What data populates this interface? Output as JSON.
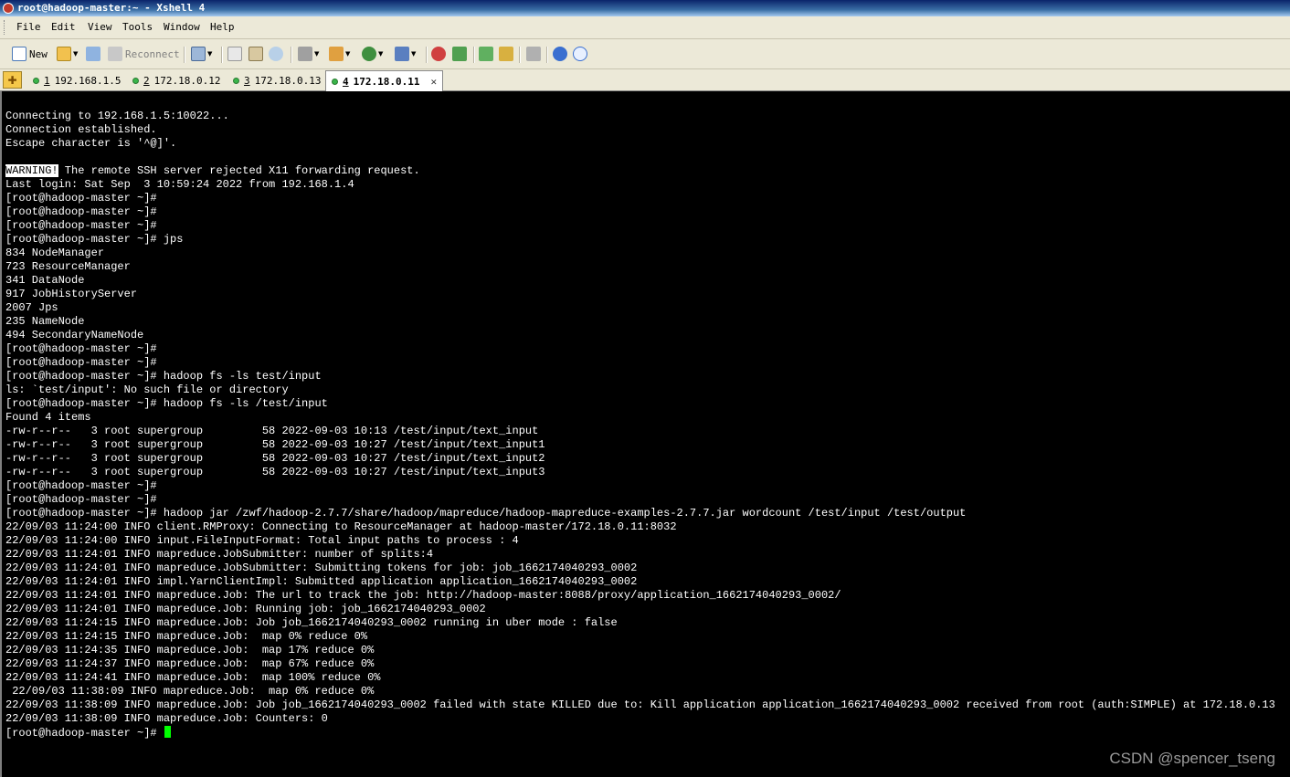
{
  "window": {
    "title": "root@hadoop-master:~ - Xshell 4"
  },
  "menu": [
    "File",
    "Edit",
    "View",
    "Tools",
    "Window",
    "Help"
  ],
  "toolbar": {
    "new_label": "New",
    "reconnect_label": "Reconnect"
  },
  "tabs": [
    {
      "num": "1",
      "host": "192.168.1.5",
      "active": false
    },
    {
      "num": "2",
      "host": "172.18.0.12",
      "active": false
    },
    {
      "num": "3",
      "host": "172.18.0.13",
      "active": false
    },
    {
      "num": "4",
      "host": "172.18.0.11",
      "active": true
    }
  ],
  "terminal": {
    "lines": [
      "Connecting to 192.168.1.5:10022...",
      "Connection established.",
      "Escape character is '^@]'.",
      "",
      "",
      "Last login: Sat Sep  3 10:59:24 2022 from 192.168.1.4",
      "[root@hadoop-master ~]#",
      "[root@hadoop-master ~]#",
      "[root@hadoop-master ~]#",
      "[root@hadoop-master ~]# jps",
      "834 NodeManager",
      "723 ResourceManager",
      "341 DataNode",
      "917 JobHistoryServer",
      "2007 Jps",
      "235 NameNode",
      "494 SecondaryNameNode",
      "[root@hadoop-master ~]#",
      "[root@hadoop-master ~]#",
      "[root@hadoop-master ~]# hadoop fs -ls test/input",
      "ls: `test/input': No such file or directory",
      "[root@hadoop-master ~]# hadoop fs -ls /test/input",
      "Found 4 items",
      "-rw-r--r--   3 root supergroup         58 2022-09-03 10:13 /test/input/text_input",
      "-rw-r--r--   3 root supergroup         58 2022-09-03 10:27 /test/input/text_input1",
      "-rw-r--r--   3 root supergroup         58 2022-09-03 10:27 /test/input/text_input2",
      "-rw-r--r--   3 root supergroup         58 2022-09-03 10:27 /test/input/text_input3",
      "[root@hadoop-master ~]#",
      "[root@hadoop-master ~]#",
      "[root@hadoop-master ~]# hadoop jar /zwf/hadoop-2.7.7/share/hadoop/mapreduce/hadoop-mapreduce-examples-2.7.7.jar wordcount /test/input /test/output",
      "22/09/03 11:24:00 INFO client.RMProxy: Connecting to ResourceManager at hadoop-master/172.18.0.11:8032",
      "22/09/03 11:24:00 INFO input.FileInputFormat: Total input paths to process : 4",
      "22/09/03 11:24:01 INFO mapreduce.JobSubmitter: number of splits:4",
      "22/09/03 11:24:01 INFO mapreduce.JobSubmitter: Submitting tokens for job: job_1662174040293_0002",
      "22/09/03 11:24:01 INFO impl.YarnClientImpl: Submitted application application_1662174040293_0002",
      "22/09/03 11:24:01 INFO mapreduce.Job: The url to track the job: http://hadoop-master:8088/proxy/application_1662174040293_0002/",
      "22/09/03 11:24:01 INFO mapreduce.Job: Running job: job_1662174040293_0002",
      "22/09/03 11:24:15 INFO mapreduce.Job: Job job_1662174040293_0002 running in uber mode : false",
      "22/09/03 11:24:15 INFO mapreduce.Job:  map 0% reduce 0%",
      "22/09/03 11:24:35 INFO mapreduce.Job:  map 17% reduce 0%",
      "22/09/03 11:24:37 INFO mapreduce.Job:  map 67% reduce 0%",
      "22/09/03 11:24:41 INFO mapreduce.Job:  map 100% reduce 0%",
      " 22/09/03 11:38:09 INFO mapreduce.Job:  map 0% reduce 0%",
      "22/09/03 11:38:09 INFO mapreduce.Job: Job job_1662174040293_0002 failed with state KILLED due to: Kill application application_1662174040293_0002 received from root (auth:SIMPLE) at 172.18.0.13",
      "22/09/03 11:38:09 INFO mapreduce.Job: Counters: 0"
    ],
    "warning": {
      "badge": "WARNING!",
      "text": " The remote SSH server rejected X11 forwarding request."
    },
    "prompt": "[root@hadoop-master ~]#"
  },
  "watermark": "CSDN @spencer_tseng",
  "colors": {
    "background": "#000000",
    "foreground": "#ffffff",
    "cursor": "#00ff00"
  }
}
